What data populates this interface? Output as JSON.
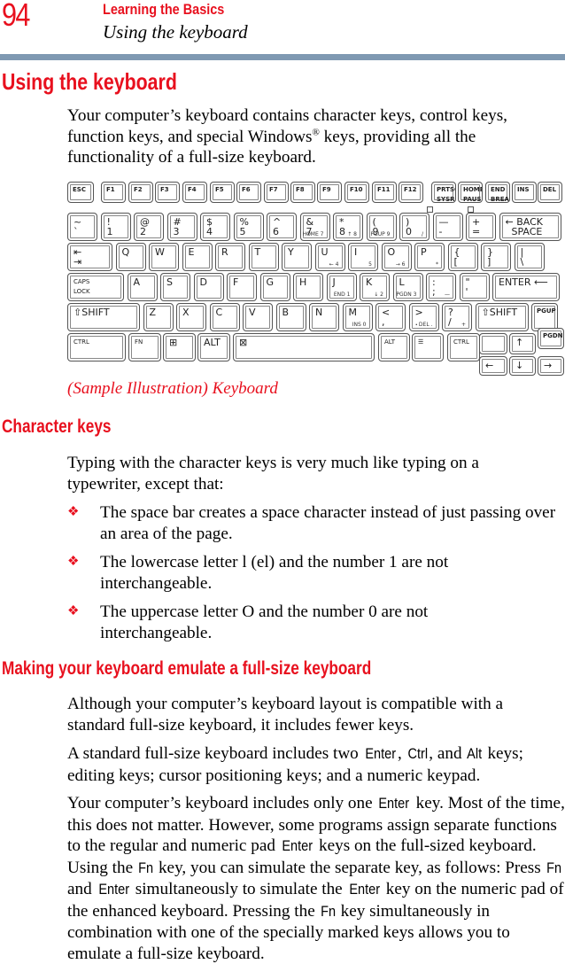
{
  "header": {
    "page_number": "94",
    "chapter": "Learning the Basics",
    "section": "Using the keyboard"
  },
  "colors": {
    "accent": "#e8101e",
    "rule": "#7f99b2"
  },
  "main": {
    "title": "Using the keyboard",
    "intro_a": "Your computer’s keyboard contains character keys, control keys, function keys, and special Windows",
    "intro_sup": "®",
    "intro_b": " keys, providing all the functionality of a full-size keyboard.",
    "caption": "(Sample Illustration) Keyboard",
    "character_keys": {
      "heading": "Character keys",
      "lead": "Typing with the character keys is very much like typing on a typewriter, except that:",
      "bullet_icon": "diamond-bullet-icon",
      "bullets": [
        "The space bar creates a space character instead of just passing over an area of the page.",
        "The lowercase letter l (el) and the number 1 are not interchangeable.",
        "The uppercase letter O and the number 0 are not interchangeable."
      ]
    },
    "emulate": {
      "heading": "Making your keyboard emulate a full-size keyboard",
      "p1": "Although your computer’s keyboard layout is compatible with a standard full-size keyboard, it includes fewer keys.",
      "p2": [
        "A standard full-size keyboard includes two ",
        "Enter",
        ", ",
        "Ctrl",
        ", and ",
        "Alt",
        " keys; editing keys; cursor positioning keys; and a numeric keypad."
      ],
      "p3": [
        "Your computer’s keyboard includes only one ",
        "Enter",
        " key. Most of the time, this does not matter. However, some programs assign separate functions to the regular and numeric pad ",
        "Enter",
        " keys on the full-sized keyboard. Using the ",
        "Fn",
        " key, you can simulate the separate key, as follows: Press ",
        "Fn",
        " and ",
        "Enter",
        " simultaneously to simulate the ",
        "Enter",
        " key on the numeric pad of the enhanced keyboard. Pressing the ",
        "Fn",
        " key simultaneously in combination with one of the specially marked keys allows you to emulate a full-size keyboard."
      ]
    }
  },
  "keyboard": {
    "function_row": [
      "ESC",
      "F1",
      "F2",
      "F3",
      "F4",
      "F5",
      "F6",
      "F7",
      "F8",
      "F9",
      "F10",
      "F11",
      "F12",
      "PRTSC\nSYSRQ",
      "HOME\nPAUSE",
      "END\nBREAK",
      "INS",
      "DEL"
    ],
    "number_row": [
      {
        "main": "~\n`"
      },
      {
        "main": "!\n1"
      },
      {
        "main": "@\n2"
      },
      {
        "main": "#\n3"
      },
      {
        "main": "$\n4"
      },
      {
        "main": "%\n5"
      },
      {
        "main": "^\n6"
      },
      {
        "main": "&\n7",
        "sub": "HOME 7"
      },
      {
        "main": "*\n8",
        "sub": "↑ 8"
      },
      {
        "main": "(\n9",
        "sub": "PGUP 9"
      },
      {
        "main": ")\n0",
        "sub": "/"
      },
      {
        "main": "—\n-"
      },
      {
        "main": "+\n="
      },
      {
        "main": "← BACK\n  SPACE"
      }
    ],
    "qwerty_row": [
      {
        "main": "⇤\n⇥"
      },
      {
        "main": "Q"
      },
      {
        "main": "W"
      },
      {
        "main": "E"
      },
      {
        "main": "R"
      },
      {
        "main": "T"
      },
      {
        "main": "Y"
      },
      {
        "main": "U",
        "sub": "← 4"
      },
      {
        "main": "I",
        "sub": "5"
      },
      {
        "main": "O",
        "sub": "→ 6"
      },
      {
        "main": "P",
        "sub": "*"
      },
      {
        "main": "{\n["
      },
      {
        "main": "}\n]"
      },
      {
        "main": "|\n\\"
      }
    ],
    "home_row": [
      {
        "main": "CAPS\nLOCK"
      },
      {
        "main": "A"
      },
      {
        "main": "S"
      },
      {
        "main": "D"
      },
      {
        "main": "F"
      },
      {
        "main": "G"
      },
      {
        "main": "H"
      },
      {
        "main": "J",
        "sub": "END 1"
      },
      {
        "main": "K",
        "sub": "↓ 2"
      },
      {
        "main": "L",
        "sub": "PGDN 3"
      },
      {
        "main": ":\n;",
        "sub": "—"
      },
      {
        "main": "\"\n'"
      },
      {
        "main": "ENTER ⟵"
      }
    ],
    "shift_row": [
      {
        "main": "⇧SHIFT"
      },
      {
        "main": "Z"
      },
      {
        "main": "X"
      },
      {
        "main": "C"
      },
      {
        "main": "V"
      },
      {
        "main": "B"
      },
      {
        "main": "N"
      },
      {
        "main": "M",
        "sub": "INS 0"
      },
      {
        "main": "<\n,"
      },
      {
        "main": ">\n.",
        "sub": "DEL ."
      },
      {
        "main": "?\n/",
        "sub": "+"
      },
      {
        "main": "⇧SHIFT"
      },
      {
        "main": "PGUP"
      }
    ],
    "bottom_row": [
      "CTRL",
      "FN",
      "⊞",
      "ALT",
      "⊠",
      "ALT",
      "☰",
      "CTRL",
      "",
      "↑",
      "PGDN"
    ],
    "arrow_row": [
      "←",
      "↓",
      "→"
    ]
  }
}
